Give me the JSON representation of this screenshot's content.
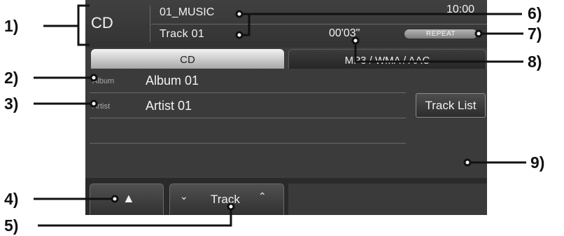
{
  "header": {
    "source": "CD",
    "folder": "01_MUSIC",
    "clock": "10:00",
    "track": "Track 01",
    "elapsed": "00'03\"",
    "repeat": "REPEAT"
  },
  "tabs": [
    {
      "label": "CD",
      "active": true
    },
    {
      "label": "MP3 / WMA / AAC",
      "active": false
    }
  ],
  "info": {
    "album_label": "Album",
    "album_value": "Album 01",
    "artist_label": "Artist",
    "artist_value": "Artist 01"
  },
  "buttons": {
    "track_list": "Track List",
    "eject": "▲",
    "track_down": "⌄",
    "track": "Track",
    "track_up": "⌃"
  },
  "callouts": [
    "1)",
    "2)",
    "3)",
    "4)",
    "5)",
    "6)",
    "7)",
    "8)",
    "9)"
  ],
  "colors": {
    "screen_bg": "#3d3d3d",
    "active_tab": "#e0e0e0",
    "repeat_badge": "#9a9a9a"
  }
}
